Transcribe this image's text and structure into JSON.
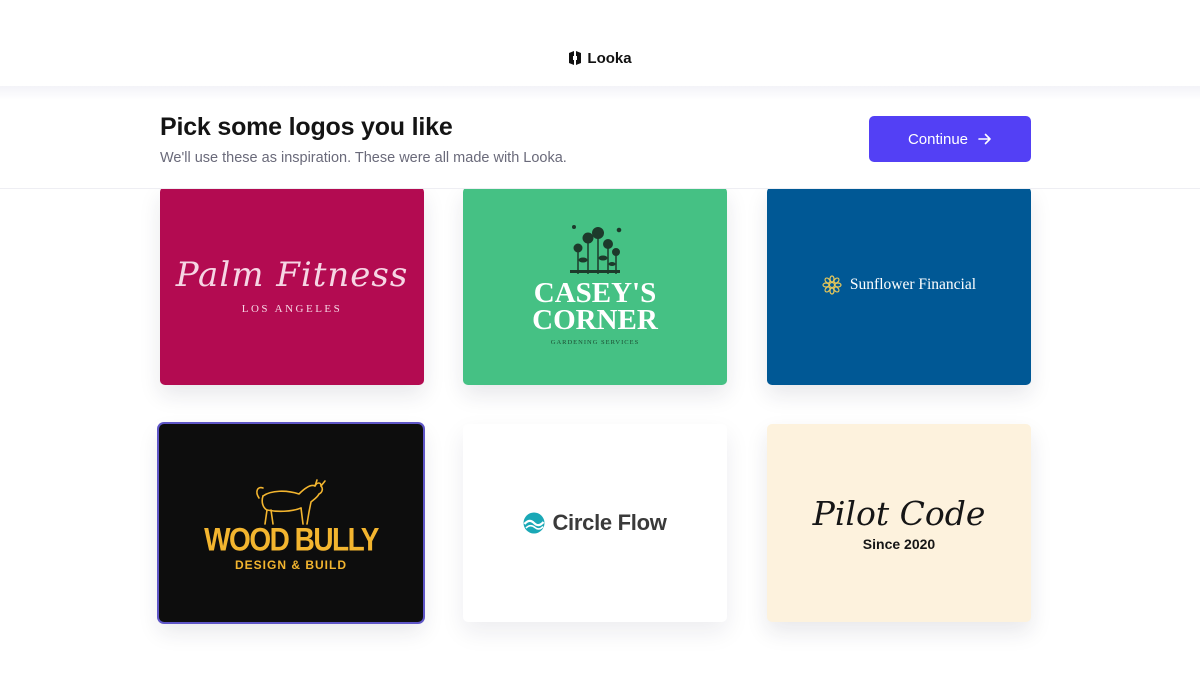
{
  "brand": {
    "name": "Looka",
    "icon": "looka-logo-icon"
  },
  "header": {
    "title": "Pick some logos you like",
    "subtitle": "We'll use these as inspiration. These were all made with Looka.",
    "continue_label": "Continue",
    "continue_icon": "arrow-right-icon",
    "accent_color": "#5340f5"
  },
  "logos": [
    {
      "title": "Palm Fitness",
      "subtitle": "LOS ANGELES",
      "background": "#b30b51"
    },
    {
      "title_line1": "CASEY'S",
      "title_line2": "CORNER",
      "subtitle": "GARDENING SERVICES",
      "background": "#45c184",
      "icon": "flowers-icon"
    },
    {
      "title": "Sunflower Financial",
      "background": "#005895",
      "icon": "sunflower-icon"
    },
    {
      "title": "WOOD BULLY",
      "subtitle": "DESIGN & BUILD",
      "background": "#0d0d0d",
      "icon": "bull-icon",
      "selected": true,
      "selected_color": "#5f56c7"
    },
    {
      "title": "Circle Flow",
      "background": "#ffffff",
      "icon": "wave-circle-icon"
    },
    {
      "title": "Pilot Code",
      "subtitle": "Since 2020",
      "background": "#fdf2dd"
    }
  ]
}
